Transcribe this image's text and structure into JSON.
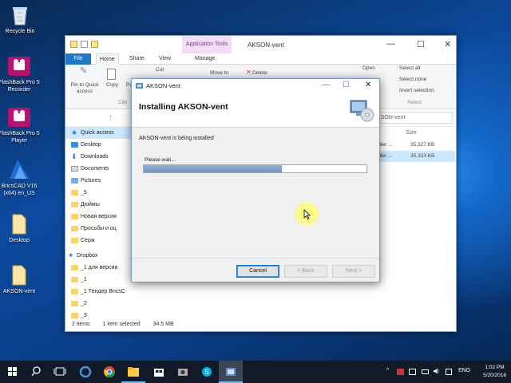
{
  "desktop": {
    "icons": [
      {
        "label": "Recycle Bin"
      },
      {
        "label": "FlashBack Pro 5 Recorder"
      },
      {
        "label": "FlashBack Pro 5 Player"
      },
      {
        "label": "BricsCAD V16 (x64) en_US"
      },
      {
        "label": "Desktop"
      },
      {
        "label": "AKSON-vent"
      }
    ]
  },
  "explorer": {
    "context_tab": "Application Tools",
    "title": "AKSON-vent",
    "tabs": [
      "File",
      "Home",
      "Share",
      "View",
      "Manage"
    ],
    "ribbon": {
      "pin": "Pin to Quick access",
      "copy": "Copy",
      "paste_trunc": "Pa",
      "cut": "Cut",
      "clip_trunc": "Clip",
      "move_to": "Move to",
      "delete": "Delete",
      "open": "Open",
      "select_all": "Select all",
      "select_none": "Select none",
      "invert": "Invert selection",
      "select_group": "Select"
    },
    "search_text": "KSON-vent",
    "nav": [
      {
        "label": "Quick access",
        "icon": "star-icon"
      },
      {
        "label": "Desktop",
        "icon": "desktop-icon"
      },
      {
        "label": "Downloads",
        "icon": "download-icon"
      },
      {
        "label": "Documents",
        "icon": "documents-icon"
      },
      {
        "label": "Pictures",
        "icon": "pictures-icon"
      },
      {
        "label": "_5",
        "icon": "folder-icon"
      },
      {
        "label": "Дюймы",
        "icon": "folder-icon"
      },
      {
        "label": "Новая версия",
        "icon": "folder-icon"
      },
      {
        "label": "Просьбы и оц",
        "icon": "folder-icon"
      },
      {
        "label": "Серж",
        "icon": "folder-icon"
      },
      {
        "label": "Dropbox",
        "icon": "dropbox-icon"
      },
      {
        "label": "_1 для версии",
        "icon": "folder-icon"
      },
      {
        "label": "_1",
        "icon": "folder-icon"
      },
      {
        "label": "_1 Тендер BricsC",
        "icon": "folder-icon"
      },
      {
        "label": "_2",
        "icon": "folder-icon"
      },
      {
        "label": "_3",
        "icon": "folder-icon"
      }
    ],
    "size_header": "Size",
    "files": [
      {
        "name": "aller ...",
        "size": "35,327 KB"
      },
      {
        "name": "aller ...",
        "size": "35,333 KB"
      }
    ],
    "status": {
      "items": "2 items",
      "selected": "1 item selected",
      "size": "34.5 MB"
    }
  },
  "installer": {
    "window_title": "AKSON-vent",
    "heading": "Installing AKSON-vent",
    "status": "AKSON-vent is being installed",
    "wait": "Please wait...",
    "progress_percent": 62,
    "buttons": {
      "cancel": "Cancel",
      "back": "< Back",
      "next": "Next >"
    }
  },
  "taskbar": {
    "lang": "ENG",
    "time": "1:02 PM",
    "date": "5/20/2016"
  }
}
